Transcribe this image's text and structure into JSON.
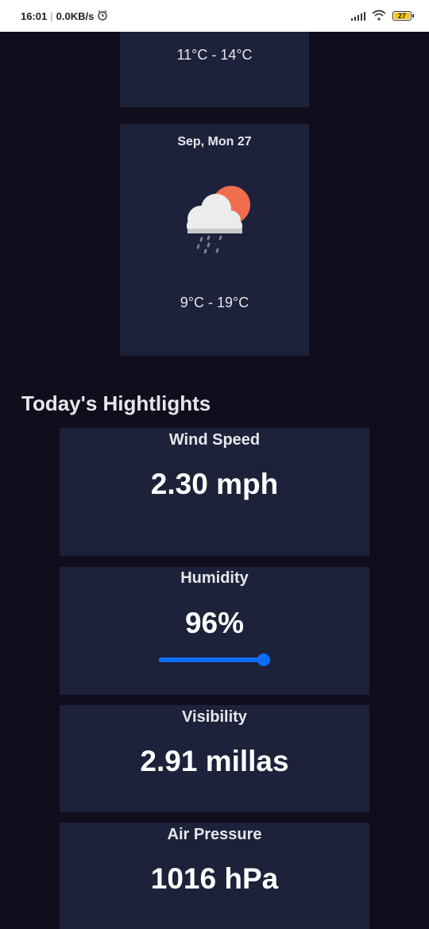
{
  "status_bar": {
    "time": "16:01",
    "speed": "0.0KB/s",
    "battery": "27",
    "icons": [
      "alarm-icon",
      "signal-icon",
      "wifi-icon",
      "battery-icon"
    ]
  },
  "forecast": [
    {
      "date": "",
      "temp_range": "11°C - 14°C"
    },
    {
      "date": "Sep, Mon 27",
      "icon": "light-rain-icon",
      "temp_range": "9°C - 19°C"
    }
  ],
  "highlights": {
    "title": "Today's Hightlights",
    "wind": {
      "label": "Wind Speed",
      "value": "2.30 mph"
    },
    "humidity": {
      "label": "Humidity",
      "value": "96%",
      "level": 0.96
    },
    "visibility": {
      "label": "Visibility",
      "value": "2.91 millas"
    },
    "air_pressure": {
      "label": "Air Pressure",
      "value": "1016 hPa"
    }
  },
  "colors": {
    "background": "#100e1d",
    "card": "#1e213a",
    "accent": "#0d6efd",
    "sun": "#ef6c4f"
  }
}
